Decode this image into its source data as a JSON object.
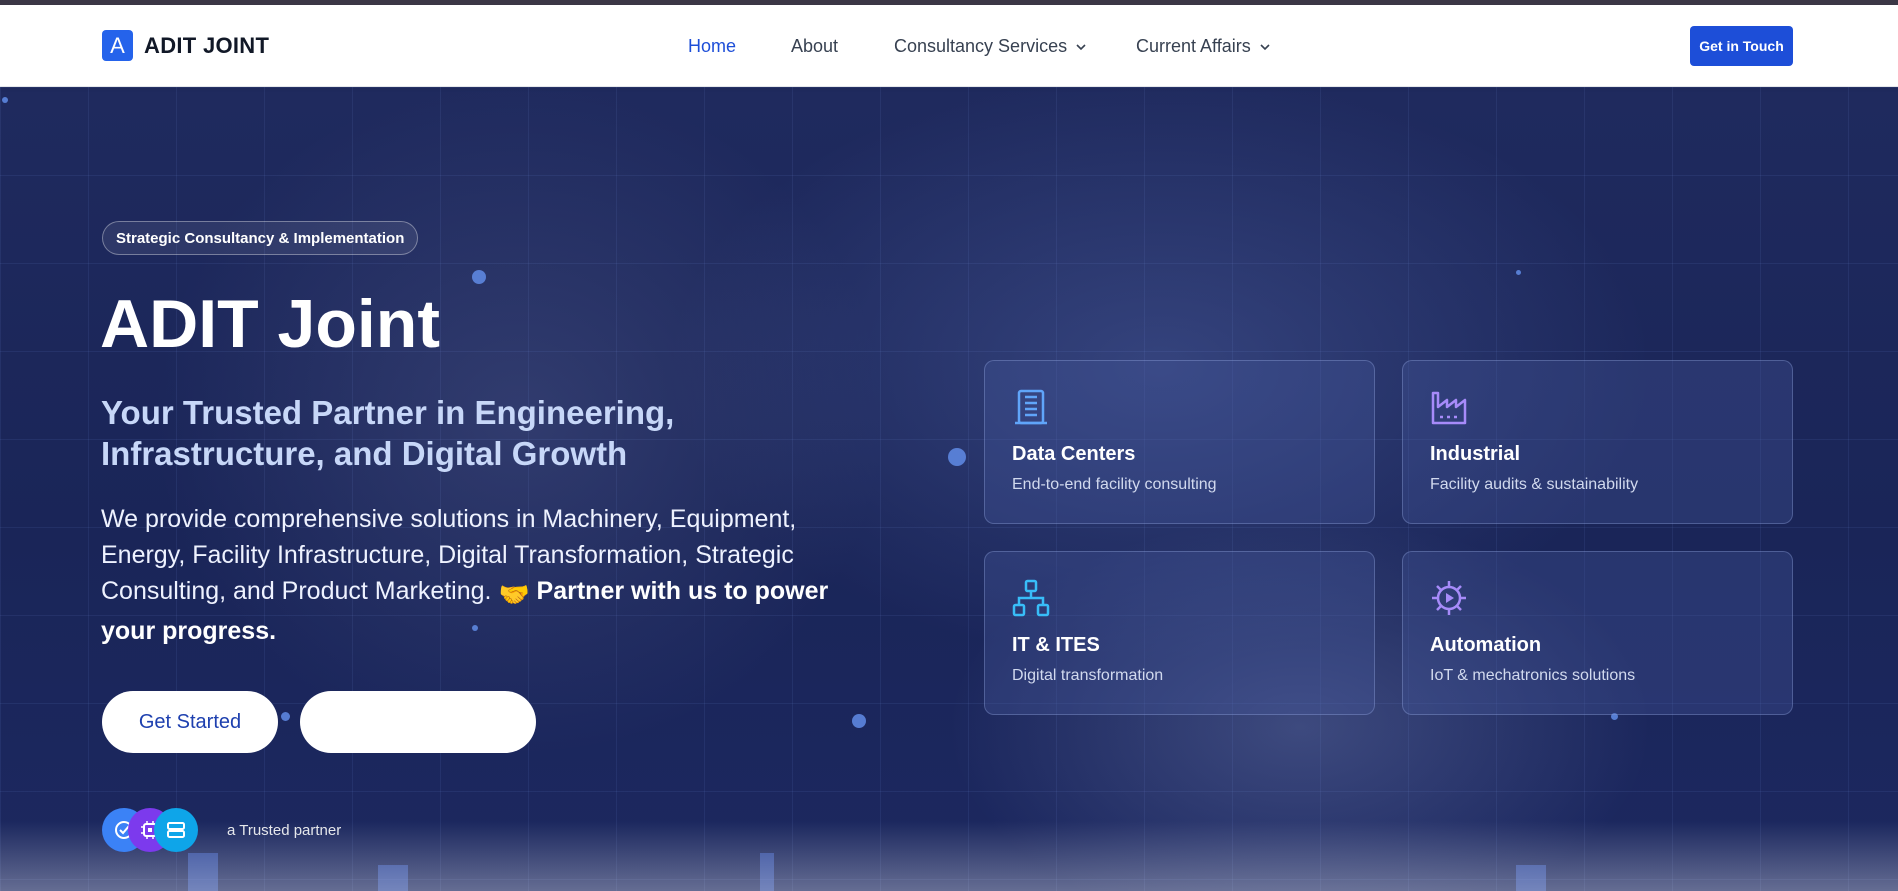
{
  "nav": {
    "brand_mark": "A",
    "brand": "ADIT JOINT",
    "links": [
      "Home",
      "About",
      "Consultancy Services",
      "Current Affairs"
    ],
    "cta": "Get in Touch"
  },
  "hero": {
    "tag": "Strategic Consultancy & Implementation",
    "title": "ADIT Joint",
    "subtitle": "Your Trusted Partner in Engineering, Infrastructure, and Digital Growth",
    "description": "We provide comprehensive solutions in Machinery, Equipment, Energy, Facility Infrastructure, Digital Transformation, Strategic Consulting, and Product Marketing.",
    "emoji": "🤝",
    "description_bold": "Partner with us to power your progress.",
    "primary_button": "Get Started",
    "secondary_button": "",
    "trusted_text": "a Trusted partner"
  },
  "cards": [
    {
      "title": "Data Centers",
      "description": "End-to-end facility consulting",
      "icon": "building-icon"
    },
    {
      "title": "Industrial",
      "description": "Facility audits & sustainability",
      "icon": "factory-icon"
    },
    {
      "title": "IT & ITES",
      "description": "Digital transformation",
      "icon": "network-icon"
    },
    {
      "title": "Automation",
      "description": "IoT & mechatronics solutions",
      "icon": "gear-play-icon"
    }
  ],
  "colors": {
    "brand_blue": "#2563eb",
    "cta_blue": "#1d4ed8",
    "hero_bg": "#1e2a5e",
    "card_icon_blue": "#60a5fa",
    "card_icon_purple": "#a78bfa",
    "card_icon_cyan": "#38bdf8"
  }
}
